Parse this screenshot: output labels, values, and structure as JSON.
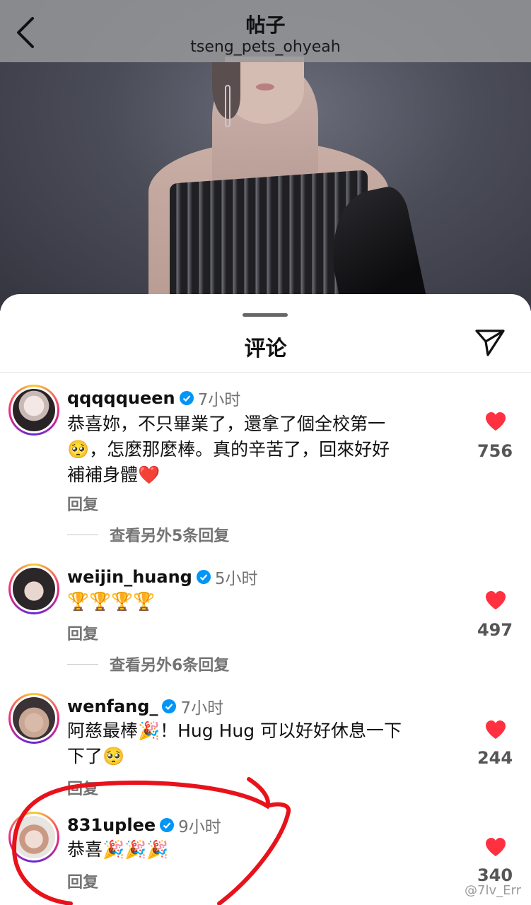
{
  "header": {
    "title": "帖子",
    "subtitle": "tseng_pets_ohyeah"
  },
  "sheet": {
    "title": "评论"
  },
  "comments": [
    {
      "username": "qqqqqueen",
      "time": "7小时",
      "text_line1": "恭喜妳，不只畢業了，還拿了個全校第一",
      "text_line2": "🥺，怎麼那麼棒。真的辛苦了，回來好好",
      "text_line3": "補補身體❤️",
      "reply": "回复",
      "view_more": "查看另外5条回复",
      "likes": "756"
    },
    {
      "username": "weijin_huang",
      "time": "5小时",
      "text_line1": "🏆🏆🏆🏆",
      "reply": "回复",
      "view_more": "查看另外6条回复",
      "likes": "497"
    },
    {
      "username": "wenfang_",
      "time": "7小时",
      "text_line1": "阿慈最棒🎉！Hug Hug 可以好好休息一下",
      "text_line2": "下了🥺",
      "reply": "回复",
      "likes": "244"
    },
    {
      "username": "831uplee",
      "time": "9小时",
      "text_line1": "恭喜🎉🎉🎉",
      "reply": "回复",
      "likes": "340"
    }
  ],
  "watermark": "@7lv_Err",
  "colors": {
    "heart": "#ff3040",
    "verified": "#0095f6",
    "annotation": "#e8121b"
  }
}
